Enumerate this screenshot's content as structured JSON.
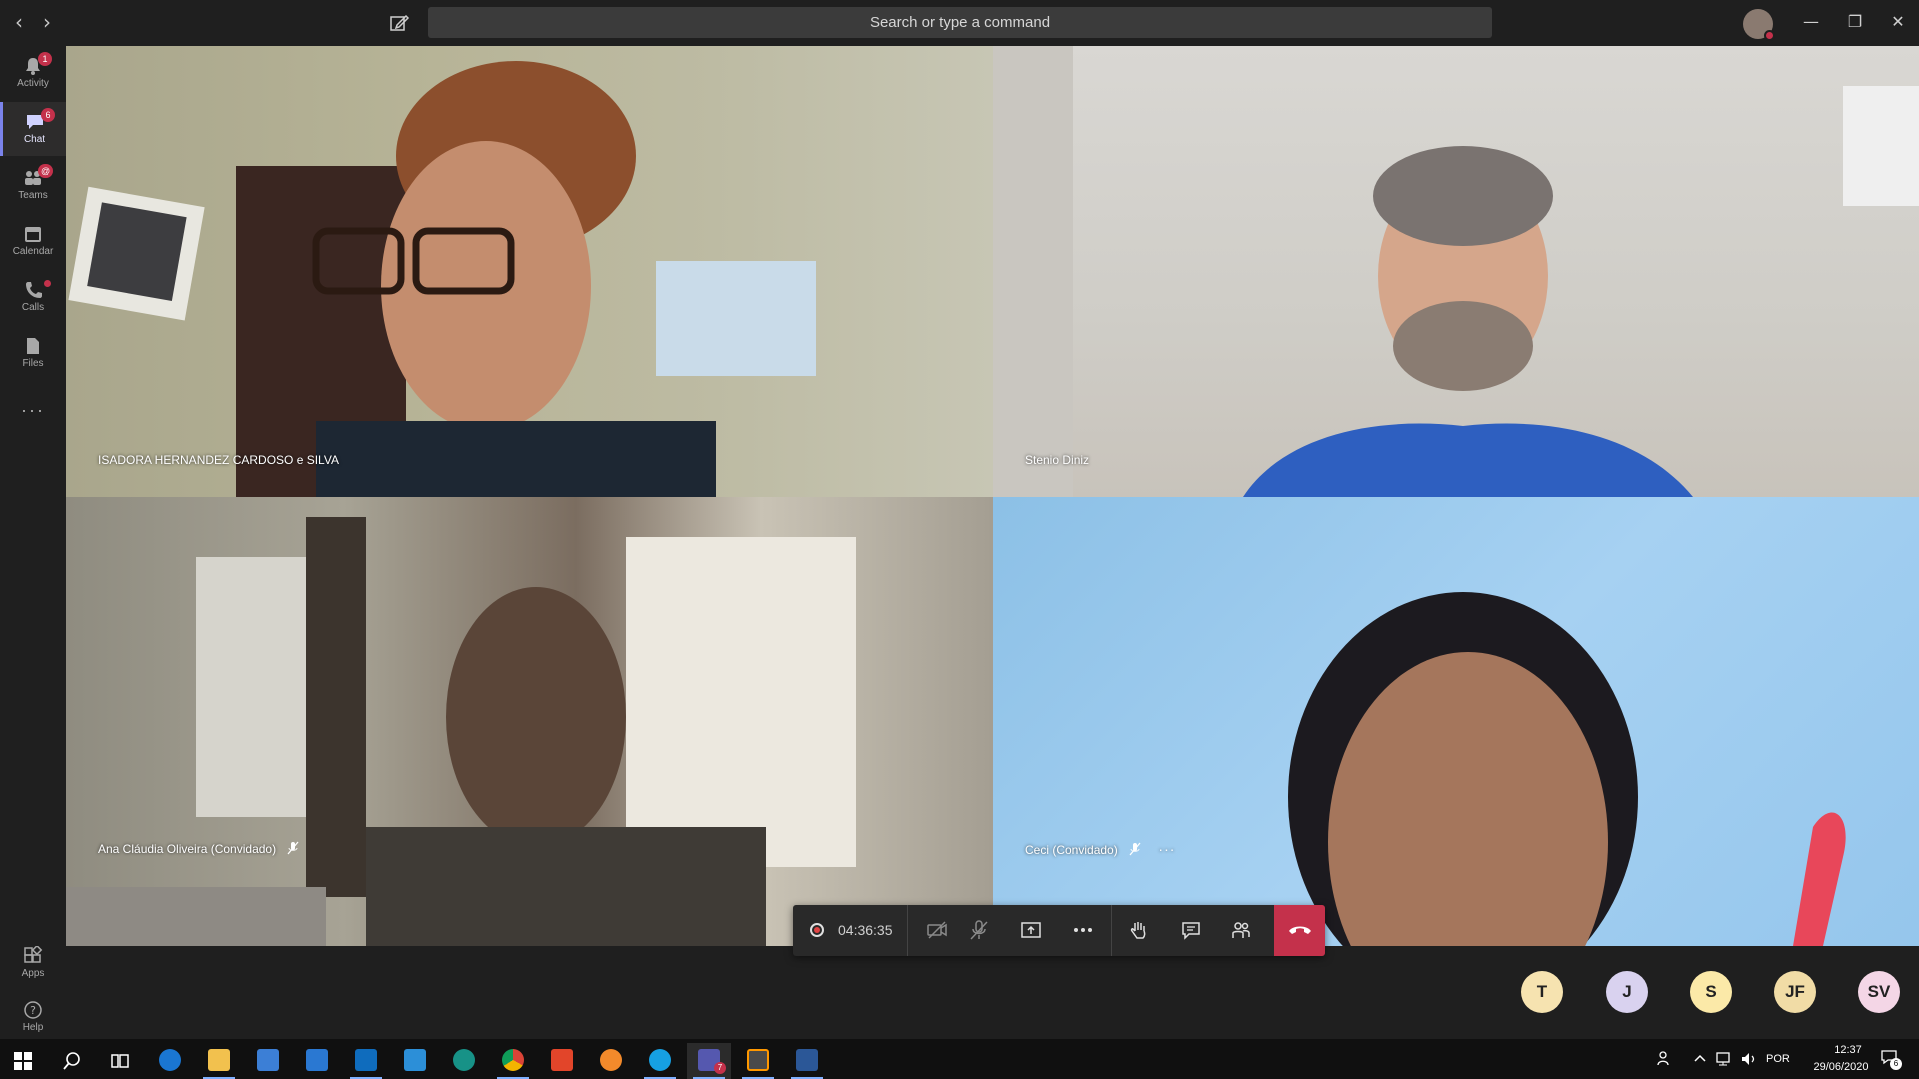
{
  "titlebar": {
    "search_placeholder": "Search or type a command",
    "back_icon": "chevron-left-icon",
    "forward_icon": "chevron-right-icon",
    "compose_icon": "compose-icon",
    "window_controls": [
      "minimize",
      "restore",
      "close"
    ]
  },
  "rail": {
    "items": [
      {
        "label": "Activity",
        "icon": "bell-icon",
        "badge": "1"
      },
      {
        "label": "Chat",
        "icon": "chat-icon",
        "badge": "6"
      },
      {
        "label": "Teams",
        "icon": "teams-icon",
        "badge": "@"
      },
      {
        "label": "Calendar",
        "icon": "calendar-icon",
        "badge": ""
      },
      {
        "label": "Calls",
        "icon": "phone-icon",
        "badge": "dot"
      },
      {
        "label": "Files",
        "icon": "file-icon",
        "badge": ""
      }
    ],
    "more": "···",
    "apps_label": "Apps",
    "help_label": "Help"
  },
  "participants": [
    {
      "name": "ISADORA HERNANDEZ CARDOSO e SILVA",
      "muted": false
    },
    {
      "name": "Stenio Diniz",
      "muted": false
    },
    {
      "name": "Ana Cláudia Oliveira (Convidado)",
      "muted": true
    },
    {
      "name": "Ceci (Convidado)",
      "muted": true,
      "more": "···"
    }
  ],
  "controls": {
    "timer": "04:36:35",
    "buttons": [
      "camera-off-icon",
      "mic-off-icon",
      "share-screen-icon",
      "more-icon",
      "raise-hand-icon",
      "chat-icon",
      "participants-icon",
      "hang-up-icon"
    ]
  },
  "bubbles": [
    {
      "initials": "T",
      "color": "#f6e3b0"
    },
    {
      "initials": "J",
      "color": "#d9d2ef"
    },
    {
      "initials": "S",
      "color": "#fbe9a8"
    },
    {
      "initials": "JF",
      "color": "#f1dca6"
    },
    {
      "initials": "SV",
      "color": "#f4d6e6"
    }
  ],
  "taskbar": {
    "apps": [
      "windows-start",
      "search",
      "task-view",
      "edge",
      "file-explorer",
      "store",
      "mail",
      "outlook",
      "vscode",
      "gitkraken",
      "chrome",
      "office",
      "firefox",
      "skype",
      "teams",
      "sublime",
      "word"
    ],
    "teams_badge": "7",
    "language": "POR",
    "time": "12:37",
    "date": "29/06/2020",
    "notif_count": "6"
  },
  "colors": {
    "accent": "#7b83eb",
    "hangup": "#c4314b",
    "badge": "#c4314b"
  }
}
